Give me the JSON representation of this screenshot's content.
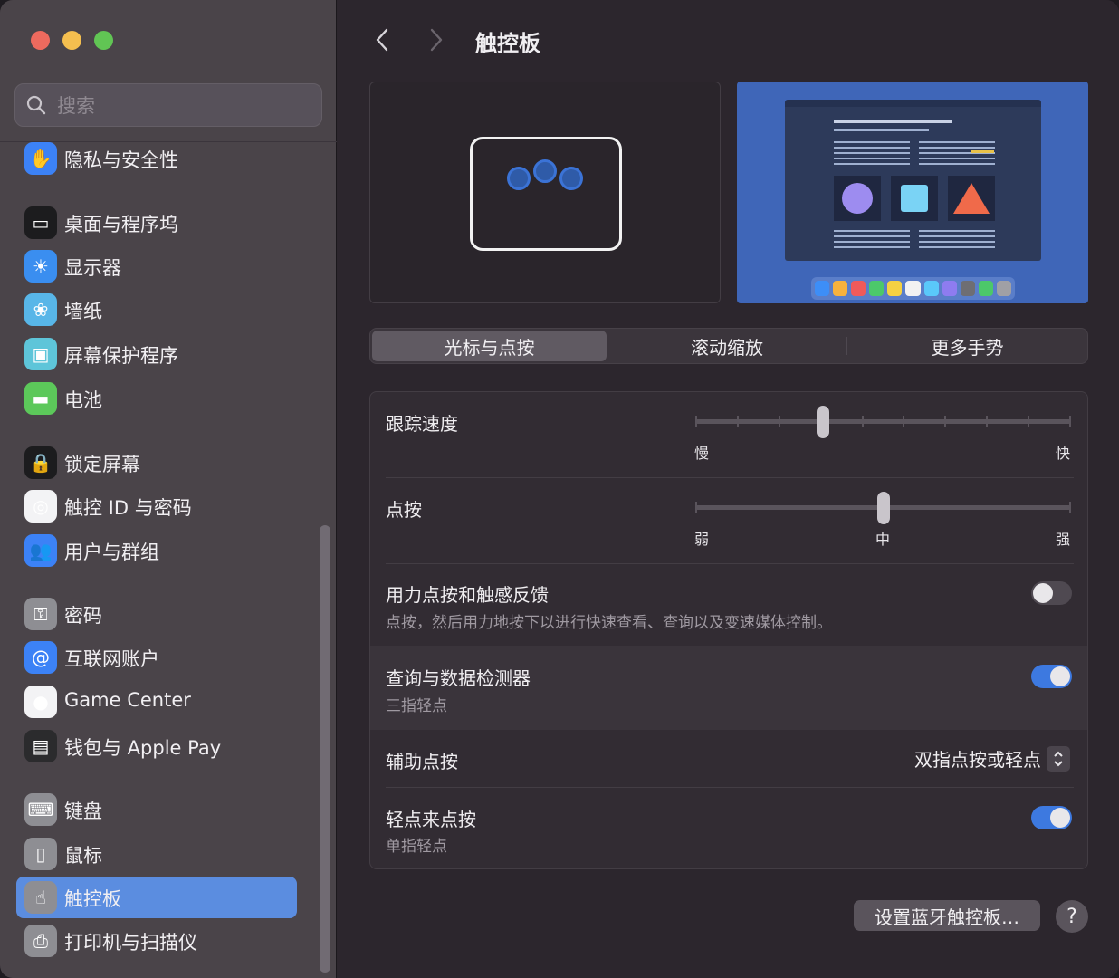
{
  "window": {
    "title": "触控板"
  },
  "search": {
    "placeholder": "搜索"
  },
  "sidebar": {
    "items": [
      {
        "label": "隐私与安全性",
        "icon": "hand-icon",
        "color": "#3c82f6",
        "glyph": "✋"
      },
      {
        "label": "桌面与程序坞",
        "icon": "dock-icon",
        "color": "#1c1c1e",
        "glyph": "▭"
      },
      {
        "label": "显示器",
        "icon": "sun-icon",
        "color": "#3a8ef0",
        "glyph": "☀"
      },
      {
        "label": "墙纸",
        "icon": "flower-icon",
        "color": "#58b6e8",
        "glyph": "❀"
      },
      {
        "label": "屏幕保护程序",
        "icon": "screensaver-icon",
        "color": "#5ec5d9",
        "glyph": "▣"
      },
      {
        "label": "电池",
        "icon": "battery-icon",
        "color": "#5cc85a",
        "glyph": "▬"
      },
      {
        "label": "锁定屏幕",
        "icon": "lock-icon",
        "color": "#1c1c1e",
        "glyph": "🔒"
      },
      {
        "label": "触控 ID 与密码",
        "icon": "fingerprint-icon",
        "color": "#f3f3f5",
        "glyph": "◎"
      },
      {
        "label": "用户与群组",
        "icon": "users-icon",
        "color": "#3c82f6",
        "glyph": "👥"
      },
      {
        "label": "密码",
        "icon": "key-icon",
        "color": "#8e8e93",
        "glyph": "⚿"
      },
      {
        "label": "互联网账户",
        "icon": "at-icon",
        "color": "#3c82f6",
        "glyph": "@"
      },
      {
        "label": "Game Center",
        "icon": "game-center-icon",
        "color": "#f3f3f5",
        "glyph": "●"
      },
      {
        "label": "钱包与 Apple Pay",
        "icon": "wallet-icon",
        "color": "#2b2b2d",
        "glyph": "▤"
      },
      {
        "label": "键盘",
        "icon": "keyboard-icon",
        "color": "#8e8e93",
        "glyph": "⌨"
      },
      {
        "label": "鼠标",
        "icon": "mouse-icon",
        "color": "#8e8e93",
        "glyph": "▯"
      },
      {
        "label": "触控板",
        "icon": "trackpad-icon",
        "color": "#8e8e93",
        "glyph": "☝"
      },
      {
        "label": "打印机与扫描仪",
        "icon": "printer-icon",
        "color": "#8e8e93",
        "glyph": "⎙"
      }
    ],
    "active_label": "触控板"
  },
  "tabs": [
    {
      "label": "光标与点按",
      "active": true
    },
    {
      "label": "滚动缩放",
      "active": false
    },
    {
      "label": "更多手势",
      "active": false
    }
  ],
  "settings": {
    "tracking_speed": {
      "label": "跟踪速度",
      "min_label": "慢",
      "max_label": "快",
      "value_fraction": 0.34
    },
    "click": {
      "label": "点按",
      "min_label": "弱",
      "mid_label": "中",
      "max_label": "强",
      "value": "中"
    },
    "force_click": {
      "label": "用力点按和触感反馈",
      "sub": "点按，然后用力地按下以进行快速查看、查询以及变速媒体控制。",
      "on": false
    },
    "lookup": {
      "label": "查询与数据检测器",
      "sub": "三指轻点",
      "on": true
    },
    "secondary_click": {
      "label": "辅助点按",
      "value": "双指点按或轻点"
    },
    "tap_to_click": {
      "label": "轻点来点按",
      "sub": "单指轻点",
      "on": true
    }
  },
  "footer": {
    "bluetooth_button": "设置蓝牙触控板…",
    "help": "?"
  },
  "colors": {
    "accent": "#3d79e0",
    "sidebar_selected": "#5b8de0"
  }
}
